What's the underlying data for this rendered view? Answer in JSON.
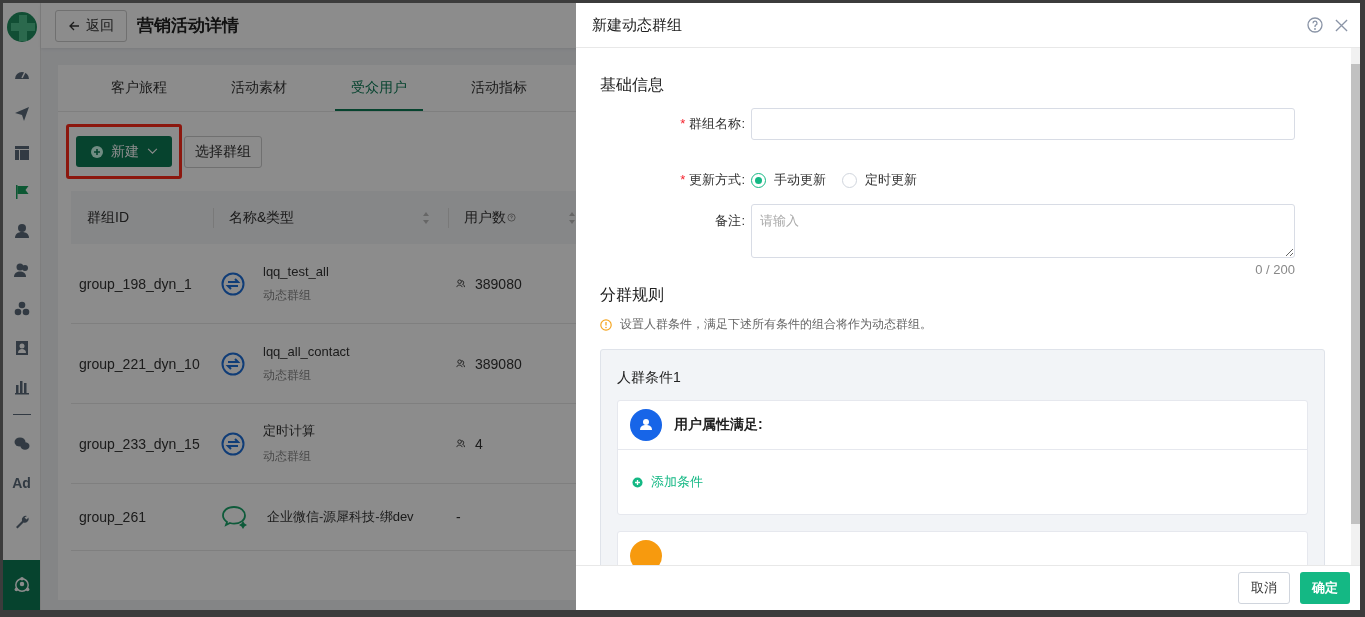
{
  "sidebar": {
    "items": [
      {
        "kind": "icon",
        "selected": false,
        "active": false
      },
      {
        "kind": "icon",
        "selected": false,
        "active": false
      },
      {
        "kind": "icon",
        "selected": false,
        "active": false
      },
      {
        "kind": "icon",
        "selected": false,
        "active": true
      },
      {
        "kind": "icon",
        "selected": false,
        "active": false
      },
      {
        "kind": "icon",
        "selected": false,
        "active": false
      },
      {
        "kind": "icon",
        "selected": false,
        "active": false
      },
      {
        "kind": "icon",
        "selected": false,
        "active": false
      },
      {
        "kind": "icon",
        "selected": false,
        "active": false
      },
      {
        "kind": "divider"
      },
      {
        "kind": "icon",
        "selected": false,
        "active": false
      },
      {
        "kind": "text",
        "label": "Ad",
        "selected": false,
        "active": false
      },
      {
        "kind": "icon",
        "selected": false,
        "active": false
      }
    ],
    "bottom": {
      "selected": true
    }
  },
  "header": {
    "back": "返回",
    "title": "营销活动详情"
  },
  "tabs": [
    {
      "label": "客户旅程",
      "selected": false
    },
    {
      "label": "活动素材",
      "selected": false
    },
    {
      "label": "受众用户",
      "selected": true
    },
    {
      "label": "活动指标",
      "selected": false
    }
  ],
  "toolbar": {
    "new": {
      "label": "新建",
      "highlighted": true
    },
    "select": "选择群组"
  },
  "table": {
    "columns": [
      {
        "label": "群组ID",
        "sortable": false,
        "help": false
      },
      {
        "label": "名称&类型",
        "sortable": true,
        "help": false
      },
      {
        "label": "用户数",
        "sortable": true,
        "help": true
      }
    ],
    "rows": [
      {
        "id": "group_198_dyn_1",
        "kind": "dynamic",
        "name": "lqq_test_all",
        "type": "动态群组",
        "users": "389080"
      },
      {
        "id": "group_221_dyn_10",
        "kind": "dynamic",
        "name": "lqq_all_contact",
        "type": "动态群组",
        "users": "389080"
      },
      {
        "id": "group_233_dyn_15",
        "kind": "dynamic",
        "name": "定时计算",
        "type": "动态群组",
        "users": "4"
      },
      {
        "id": "group_261",
        "kind": "wechat",
        "name": "企业微信-源犀科技-绑dev",
        "users": "-"
      }
    ]
  },
  "drawer": {
    "title": "新建动态群组",
    "basic": {
      "title": "基础信息",
      "name": {
        "label": "群组名称:",
        "mark": "*"
      },
      "update": {
        "label": "更新方式:",
        "mark": "*",
        "options": [
          {
            "label": "手动更新",
            "selected": true
          },
          {
            "label": "定时更新",
            "selected": false
          }
        ]
      },
      "note": {
        "label": "备注:",
        "placeholder": "请输入",
        "count": "0 / 200"
      }
    },
    "rules": {
      "title": "分群规则",
      "hint": "设置人群条件，满足下述所有条件的组合将作为动态群组。",
      "group_title": "人群条件1",
      "cards": [
        {
          "kind": "user",
          "title": "用户属性满足:",
          "add": "添加条件"
        },
        {
          "kind": "event"
        }
      ]
    },
    "buttons": {
      "cancel": "取消",
      "ok": "确定"
    }
  }
}
